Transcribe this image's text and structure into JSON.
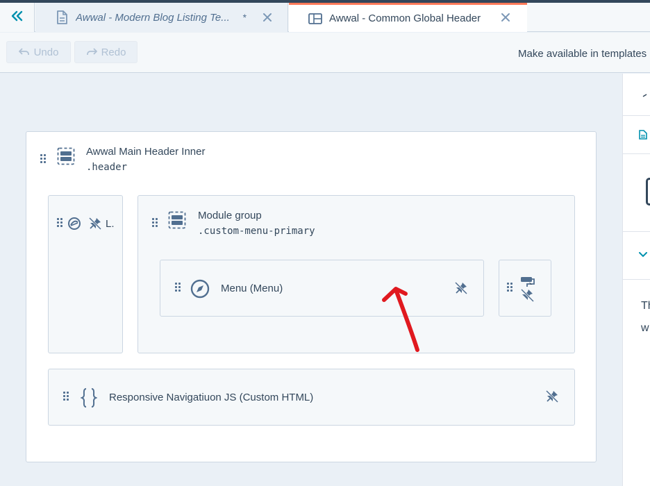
{
  "tabs": [
    {
      "label": "Awwal - Modern Blog Listing Te...",
      "dirty_marker": "*",
      "icon": "document-icon",
      "active": false
    },
    {
      "label": "Awwal - Common Global Header",
      "icon": "layout-icon",
      "active": true
    }
  ],
  "toolbar": {
    "undo_label": "Undo",
    "redo_label": "Redo",
    "make_available_label": "Make available in templates"
  },
  "layout": {
    "main_header": {
      "title": "Awwal Main Header Inner",
      "class_name": ".header"
    },
    "logo_module": {
      "label": "L."
    },
    "module_group": {
      "title": "Module group",
      "class_name": ".custom-menu-primary"
    },
    "menu_module": {
      "label": "Menu (Menu)"
    },
    "custom_html_module": {
      "label": "Responsive Navigatiuon JS (Custom HTML)"
    }
  },
  "right_panel": {
    "text_line1": "Th",
    "text_line2": "w"
  },
  "colors": {
    "accent_tab": "#ff7a59",
    "icon_blue": "#516f90",
    "annotation_arrow": "#e0191f",
    "teal": "#0091ae"
  }
}
